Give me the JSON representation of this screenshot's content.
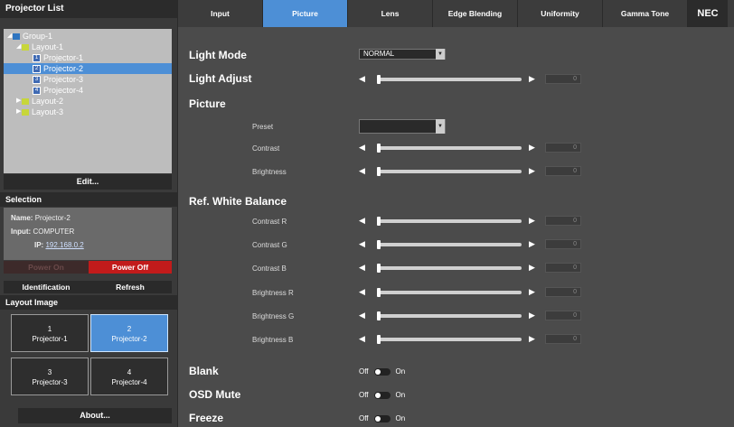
{
  "left": {
    "projector_list_title": "Projector List",
    "tree": [
      {
        "label": "Group-1",
        "level": 0
      },
      {
        "label": "Layout-1",
        "level": 1
      },
      {
        "label": "Projector-1",
        "level": 2,
        "badge": "1"
      },
      {
        "label": "Projector-2",
        "level": 2,
        "badge": "2",
        "selected": true
      },
      {
        "label": "Projector-3",
        "level": 2,
        "badge": "3"
      },
      {
        "label": "Projector-4",
        "level": 2,
        "badge": "4"
      },
      {
        "label": "Layout-2",
        "level": 1
      },
      {
        "label": "Layout-3",
        "level": 1
      }
    ],
    "edit_label": "Edit...",
    "selection_title": "Selection",
    "selection": {
      "name_key": "Name:",
      "name_val": "Projector-2",
      "input_key": "Input:",
      "input_val": "COMPUTER",
      "ip_key": "IP:",
      "ip_val": "192.168.0.2"
    },
    "power_on": "Power On",
    "power_off": "Power Off",
    "identification": "Identification",
    "refresh": "Refresh",
    "layout_image_title": "Layout Image",
    "thumbs": [
      {
        "num": "1",
        "name": "Projector-1"
      },
      {
        "num": "2",
        "name": "Projector-2",
        "selected": true
      },
      {
        "num": "3",
        "name": "Projector-3"
      },
      {
        "num": "4",
        "name": "Projector-4"
      }
    ],
    "about": "About..."
  },
  "tabs": [
    "Input",
    "Picture",
    "Lens",
    "Edge Blending",
    "Uniformity",
    "Gamma Tone"
  ],
  "active_tab": "Picture",
  "brand": "NEC",
  "main": {
    "light_mode_label": "Light Mode",
    "light_mode_value": "NORMAL",
    "light_adjust_label": "Light Adjust",
    "picture_label": "Picture",
    "preset_label": "Preset",
    "contrast_label": "Contrast",
    "brightness_label": "Brightness",
    "ref_white_label": "Ref. White Balance",
    "wb": [
      "Contrast R",
      "Contrast G",
      "Contrast B",
      "Brightness R",
      "Brightness G",
      "Brightness B"
    ],
    "slider_value": "0",
    "blank_label": "Blank",
    "osd_label": "OSD Mute",
    "freeze_label": "Freeze",
    "off": "Off",
    "on": "On"
  },
  "colors": {
    "accent": "#4d8fd6",
    "danger": "#c21b1b"
  }
}
